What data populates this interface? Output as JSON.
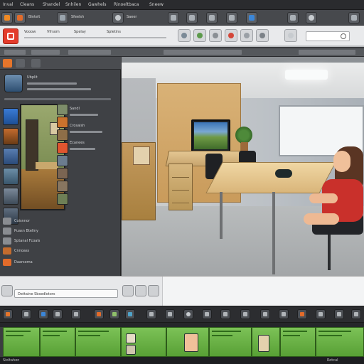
{
  "menu": {
    "items": [
      "Inval",
      "Cleans",
      "Shandel",
      "Snhilen",
      "Gawhels",
      "Rinoeltbaca",
      "Sneew"
    ]
  },
  "toolbar": {
    "labels": [
      "Bintelt",
      "Sfeelsh",
      "Saeer"
    ]
  },
  "ribbon": {
    "groups": [
      "Vooow",
      "Vfrsom",
      "Spelay",
      "Spletins"
    ],
    "search_placeholder": ""
  },
  "left_panel": {
    "heading": "Ubplit",
    "list_rows": [
      "Sandl",
      "Crosalsh",
      "Ecanees"
    ],
    "bottom_rows": [
      "Coisnnor",
      "Puasn Bteliny",
      "Sptanal Fcoals",
      "Cnnoass",
      "Daarsoma"
    ]
  },
  "propbar": {
    "field_text": "Dettaine Sbsedlotors"
  },
  "status": {
    "left": "Sioltahon",
    "right": "Rotcul"
  },
  "colors": {
    "accent_red": "#e33c2c",
    "clip_green": "#6fb64b",
    "panel_dark": "#3f4145"
  }
}
